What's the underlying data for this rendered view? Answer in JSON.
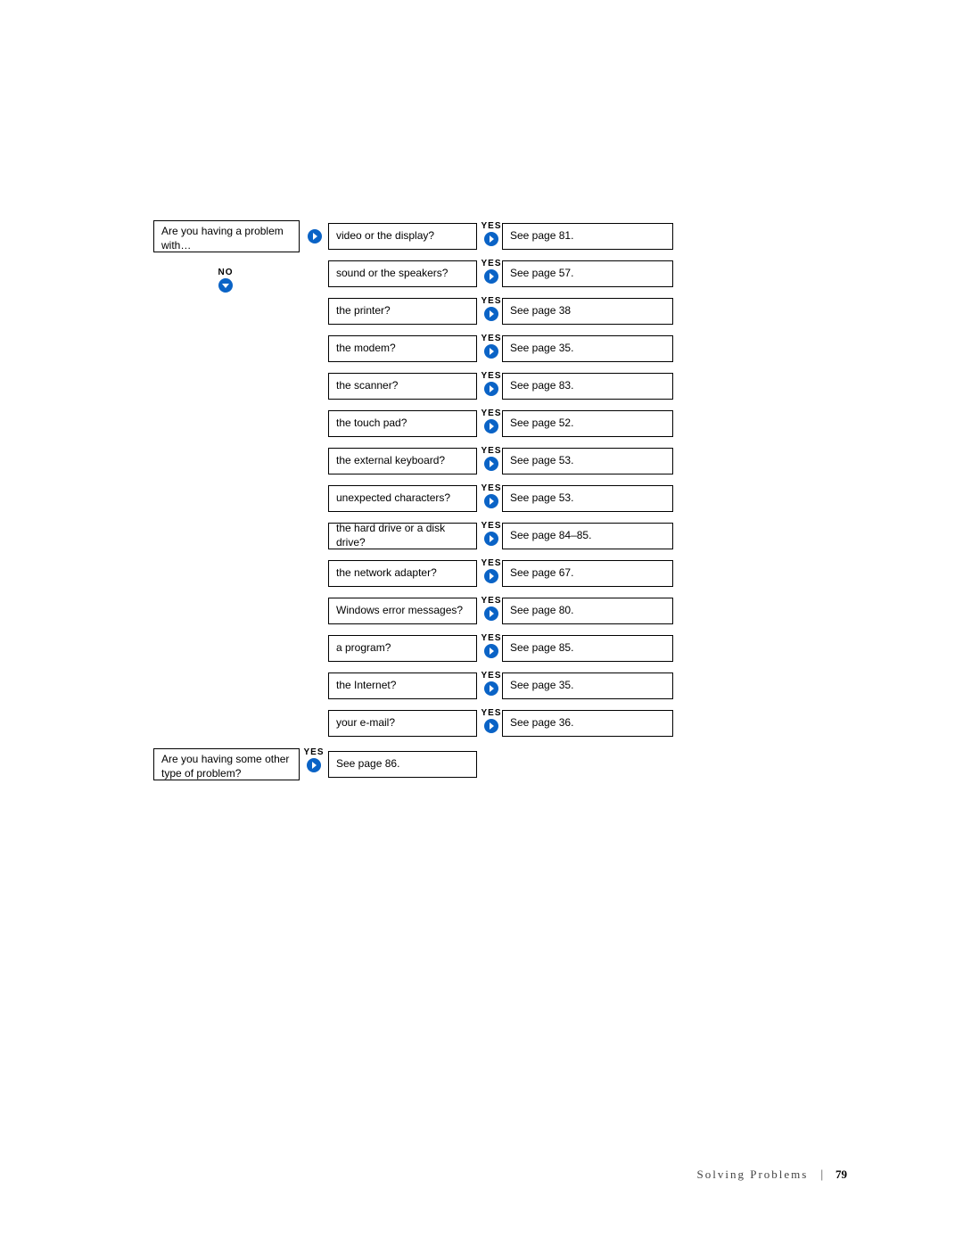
{
  "labels": {
    "yes": "YES",
    "no": "NO"
  },
  "top_question": "Are you having a problem with…",
  "rows": [
    {
      "q": "video or the display?",
      "a": "See page 81."
    },
    {
      "q": "sound or the speakers?",
      "a": "See page 57."
    },
    {
      "q": "the printer?",
      "a": "See page 38"
    },
    {
      "q": "the modem?",
      "a": "See page 35."
    },
    {
      "q": "the scanner?",
      "a": "See page 83."
    },
    {
      "q": "the touch pad?",
      "a": "See page 52."
    },
    {
      "q": "the external keyboard?",
      "a": "See page 53."
    },
    {
      "q": "unexpected characters?",
      "a": "See page 53."
    },
    {
      "q": "the hard drive or a disk drive?",
      "a": "See page 84–85."
    },
    {
      "q": "the network adapter?",
      "a": "See page 67."
    },
    {
      "q": "Windows error messages?",
      "a": "See page 80."
    },
    {
      "q": "a program?",
      "a": "See page 85."
    },
    {
      "q": "the Internet?",
      "a": "See page 35."
    },
    {
      "q": "your e-mail?",
      "a": "See page 36."
    }
  ],
  "bottom_question": "Are you having some other type of problem?",
  "bottom_answer": "See page 86.",
  "footer": {
    "section": "Solving Problems",
    "page": "79"
  },
  "colors": {
    "accent": "#0a63c6"
  }
}
